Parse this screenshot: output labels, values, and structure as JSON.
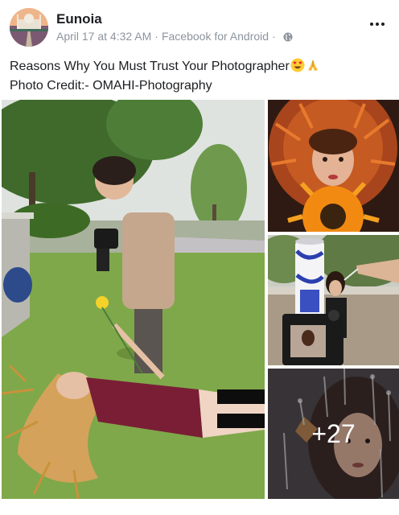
{
  "post": {
    "page_name": "Eunoia",
    "timestamp": "April 17 at 4:32 AM",
    "separator": "·",
    "source": "Facebook for Android",
    "privacy_icon": "globe-icon",
    "menu_icon": "more-options-icon",
    "caption_line1": "Reasons Why You Must Trust Your Photographer",
    "caption_emojis": [
      "heart-eyes-emoji",
      "folded-hands-emoji"
    ],
    "caption_line2": "Photo Credit:- OMAHI-Photography"
  },
  "photos": {
    "more_count": "+27"
  }
}
